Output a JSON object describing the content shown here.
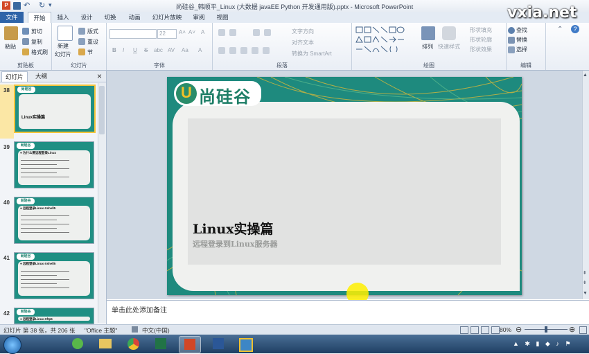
{
  "window": {
    "title": "尚硅谷_韩顺平_Linux (大数据 javaEE Python 开发通用版).pptx - Microsoft PowerPoint",
    "app_icon": "P",
    "watermark": "vxia.net"
  },
  "tabs": [
    "文件",
    "开始",
    "插入",
    "设计",
    "切换",
    "动画",
    "幻灯片放映",
    "审阅",
    "视图"
  ],
  "ribbon": {
    "clipboard": {
      "paste": "粘贴",
      "cut": "剪切",
      "copy": "复制",
      "format_painter": "格式刷",
      "label": "剪贴板"
    },
    "slides": {
      "new_slide_1": "新建",
      "new_slide_2": "幻灯片",
      "layout": "版式",
      "reset": "重设",
      "section": "节",
      "label": "幻灯片"
    },
    "font": {
      "font_size": "22",
      "bold": "B",
      "italic": "I",
      "underline": "U",
      "strike": "S",
      "shadow": "abc",
      "spacing": "AV",
      "case": "Aa",
      "color": "A",
      "grow": "A˄",
      "shrink": "A˅",
      "clear": "A",
      "label": "字体"
    },
    "paragraph": {
      "text_direction": "文字方向",
      "align_text": "对齐文本",
      "smartart": "转换为 SmartArt",
      "label": "段落"
    },
    "drawing": {
      "arrange": "排列",
      "quick_styles": "快速样式",
      "shape_fill": "形状填充",
      "shape_outline": "形状轮廓",
      "shape_effects": "形状效果",
      "label": "绘图"
    },
    "editing": {
      "find": "查找",
      "replace": "替换",
      "select": "选择",
      "label": "编辑"
    }
  },
  "left_panel": {
    "tab_slides": "幻灯片",
    "tab_outline": "大纲",
    "close": "×",
    "thumbs": [
      {
        "num": "38",
        "title": "Linux实操篇",
        "logo": "尚硅谷"
      },
      {
        "num": "39",
        "title": "● 为什么要远程登录Linux",
        "logo": "尚硅谷"
      },
      {
        "num": "40",
        "title": "● 远程登录Linux-Xshell5",
        "logo": "尚硅谷"
      },
      {
        "num": "41",
        "title": "● 远程登录Linux-Xshell5",
        "logo": "尚硅谷"
      },
      {
        "num": "42",
        "title": "● 远程登录Linux-Xftp5",
        "logo": "尚硅谷"
      }
    ]
  },
  "slide": {
    "logo_text": "尚硅谷",
    "logo_mark": "U",
    "title": "Linux实操篇",
    "subtitle": "远程登录到Linux服务器"
  },
  "notes": {
    "placeholder": "单击此处添加备注"
  },
  "status": {
    "slide_info": "幻灯片 第 38 张，共 206 张",
    "theme": "\"Office 主题\"",
    "language": "中文(中国)",
    "zoom": "80%",
    "zoom_fraction": 0.5
  },
  "colors": {
    "accent": "#1e8a7e",
    "file_tab": "#2f64a8",
    "highlight": "#f3c43a"
  }
}
